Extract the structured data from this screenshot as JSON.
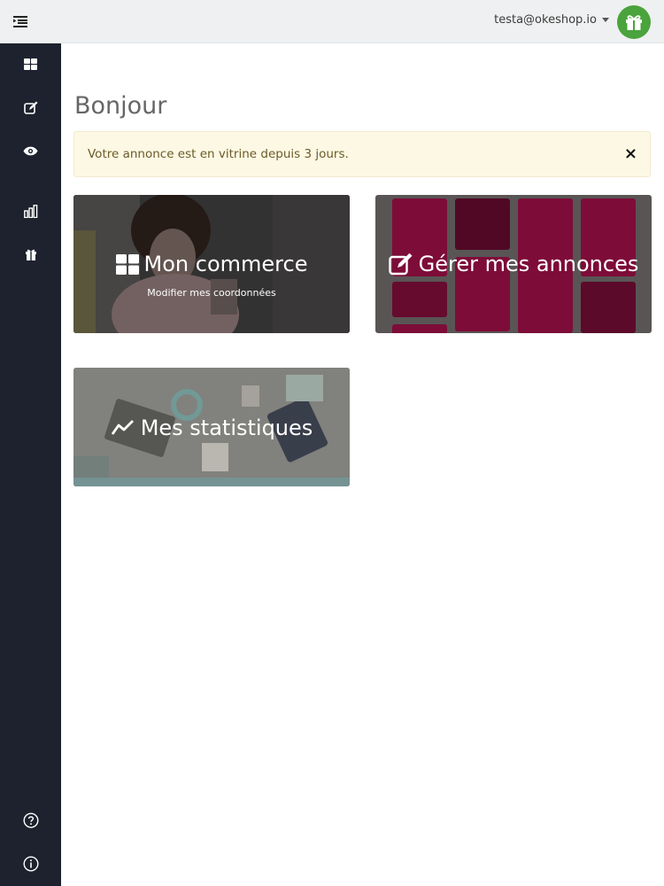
{
  "topbar": {
    "user_email": "testa@okeshop.io"
  },
  "sidebar": {
    "items": [
      {
        "icon": "dashboard-icon"
      },
      {
        "icon": "edit-icon"
      },
      {
        "icon": "eye-icon"
      },
      {
        "icon": "bar-chart-icon"
      },
      {
        "icon": "gift-icon"
      }
    ],
    "bottom_items": [
      {
        "icon": "help-icon"
      },
      {
        "icon": "info-icon"
      }
    ]
  },
  "main": {
    "title": "Bonjour",
    "alert": {
      "message": "Votre annonce est en vitrine depuis 3 jours.",
      "close": "×"
    },
    "tiles": {
      "commerce": {
        "title": "Mon commerce",
        "subtitle": "Modifier mes coordonnées",
        "icon": "dashboard-icon"
      },
      "annonces": {
        "title": "Gérer mes annonces",
        "icon": "edit-icon"
      },
      "stats": {
        "title": "Mes statistiques",
        "icon": "line-chart-icon"
      }
    }
  },
  "colors": {
    "sidebar": "#1d222e",
    "topbar": "#eef0f1",
    "gift_button": "#4aa33c",
    "alert_bg": "#fcf8e3",
    "annonces_accent": "#7d0c38"
  }
}
